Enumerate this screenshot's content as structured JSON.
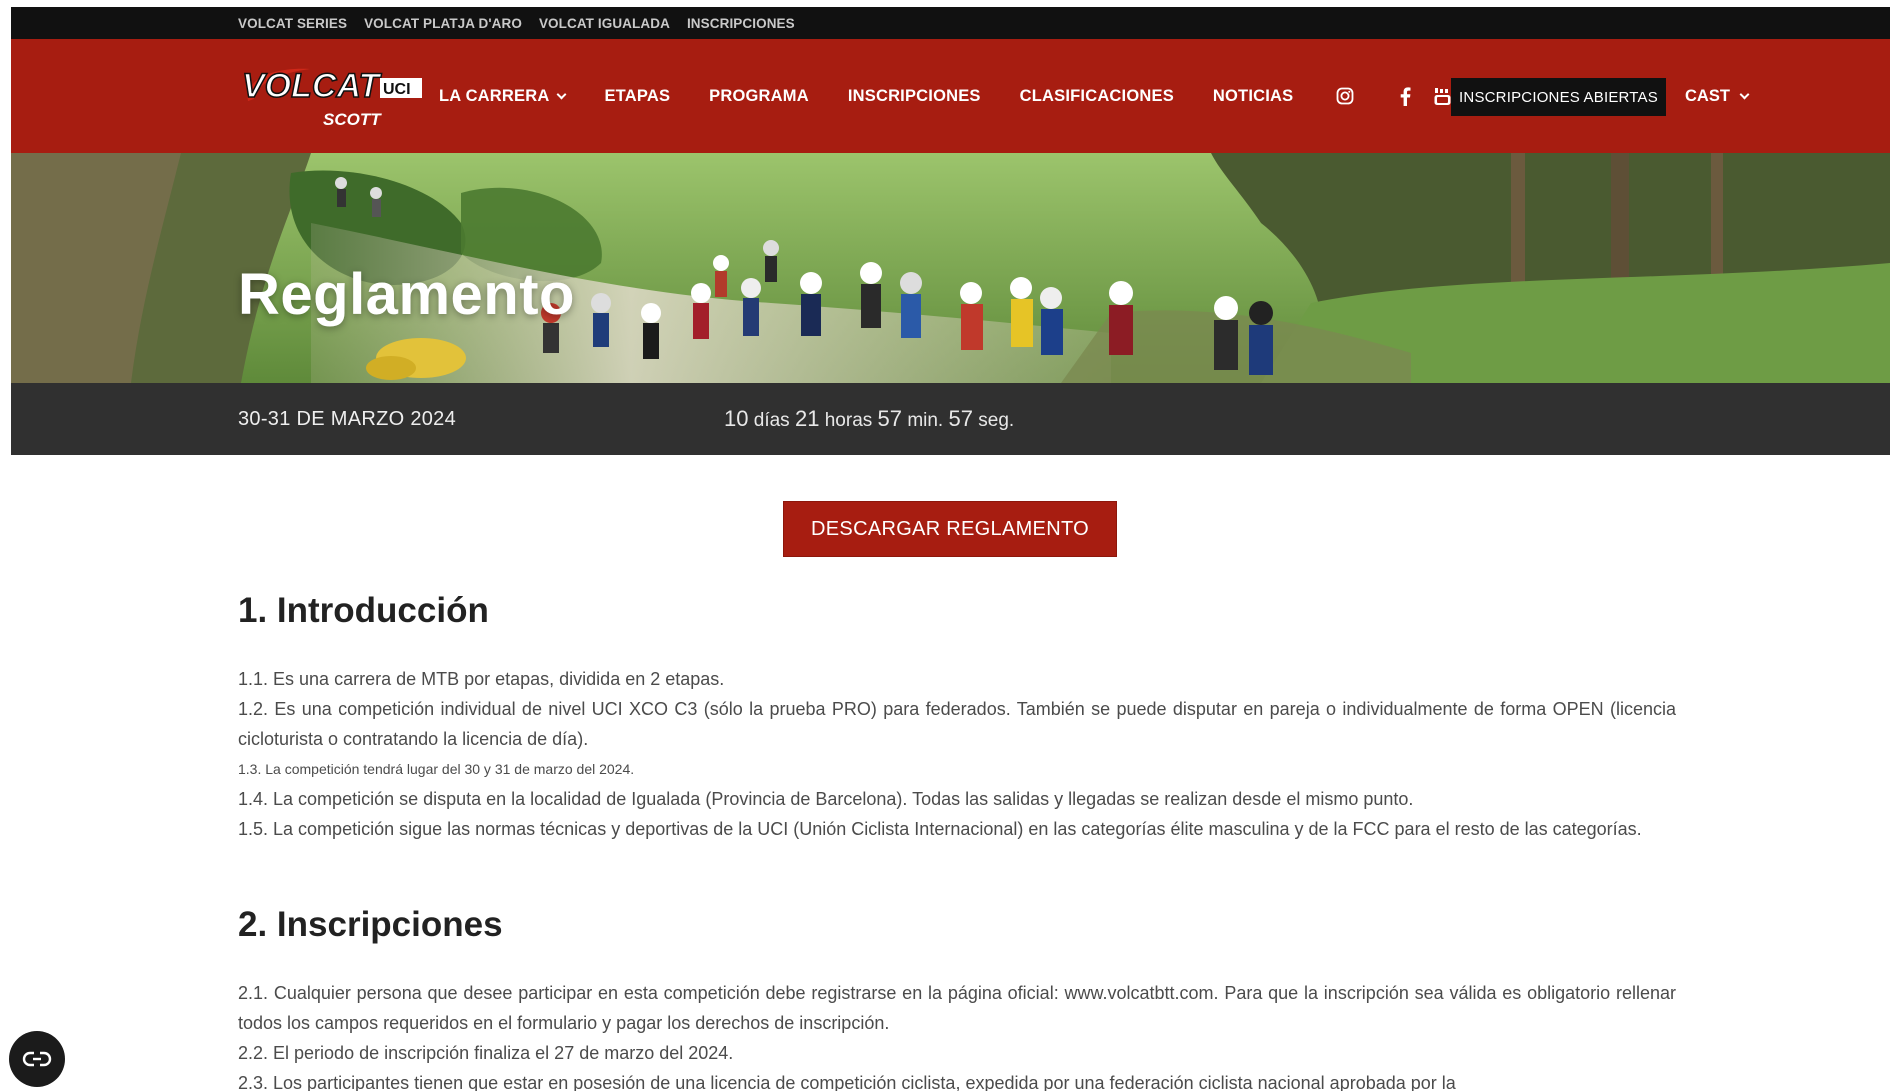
{
  "topbar": {
    "links": [
      "VOLCAT SERIES",
      "VOLCAT PLATJA D'ARO",
      "VOLCAT IGUALADA",
      "INSCRIPCIONES"
    ]
  },
  "logo": {
    "main": "VOLCAT",
    "badge": "UCI",
    "sponsor": "SCOTT"
  },
  "nav": {
    "items": [
      "LA CARRERA",
      "ETAPAS",
      "PROGRAMA",
      "INSCRIPCIONES",
      "CLASIFICACIONES",
      "NOTICIAS"
    ],
    "cta": "INSCRIPCIONES ABIERTAS",
    "lang": "CAST"
  },
  "hero": {
    "title": "Reglamento"
  },
  "event": {
    "date": "30-31 DE MARZO 2024",
    "countdown": {
      "days": "10",
      "days_label": "días",
      "hours": "21",
      "hours_label": "horas",
      "minutes": "57",
      "minutes_label": "min.",
      "seconds": "57",
      "seconds_label": "seg."
    }
  },
  "content": {
    "download_button": "DESCARGAR REGLAMENTO",
    "sections": [
      {
        "heading": "1. Introducción",
        "paragraphs": [
          "1.1. Es una carrera de MTB por etapas, dividida en 2 etapas.",
          "1.2. Es una competición individual de nivel UCI XCO C3 (sólo la prueba PRO) para federados. También se puede disputar en pareja o individualmente de forma OPEN (licencia cicloturista o contratando la licencia de día).",
          "1.3. La competición tendrá lugar del 30 y 31 de marzo del 2024.",
          "1.4. La competición se disputa en la localidad de Igualada (Provincia de Barcelona). Todas las salidas y llegadas se realizan desde el mismo punto.",
          "1.5. La competición sigue las normas técnicas y deportivas de la UCI (Unión Ciclista Internacional) en las categorías élite masculina y de la FCC para el resto de las categorías."
        ]
      },
      {
        "heading": "2. Inscripciones",
        "paragraphs": [
          "2.1. Cualquier persona que desee participar en esta competición debe registrarse en la página oficial: www.volcatbtt.com. Para que la inscripción sea válida es obligatorio rellenar todos los campos requeridos en el formulario y pagar los derechos de inscripción.",
          "2.2. El periodo de inscripción finaliza el 27 de marzo del 2024.",
          "2.3. Los participantes tienen que estar en posesión de una licencia de competición ciclista, expedida por una federación ciclista nacional aprobada por la"
        ]
      }
    ]
  },
  "colors": {
    "brand_red": "#a71d11",
    "dark_bar": "#303030",
    "topbar": "#111111"
  },
  "icons": [
    "instagram-icon",
    "facebook-icon",
    "youtube-icon",
    "chevron-down-icon",
    "cookie-settings-icon"
  ]
}
